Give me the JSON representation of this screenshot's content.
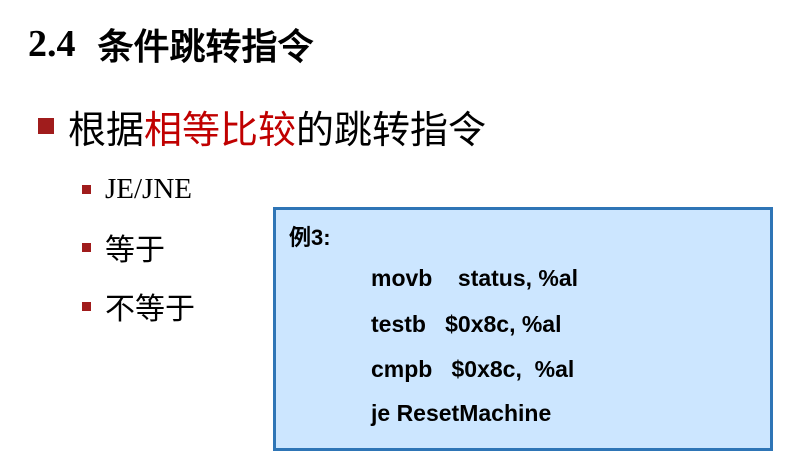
{
  "title": {
    "number": "2.4",
    "text": "条件跳转指令"
  },
  "main_bullet": {
    "prefix": "根据",
    "highlight": "相等比较",
    "suffix": "的跳转指令",
    "highlight_color": "#c00000"
  },
  "sub_bullets": [
    "JE/JNE",
    "等于",
    "不等于"
  ],
  "example": {
    "label": "例3:",
    "code": [
      "movb    status, %al",
      "testb   $0x8c, %al",
      "cmpb   $0x8c,  %al",
      "je ResetMachine"
    ],
    "background": "#cce6ff",
    "border": "#2e75b6"
  }
}
